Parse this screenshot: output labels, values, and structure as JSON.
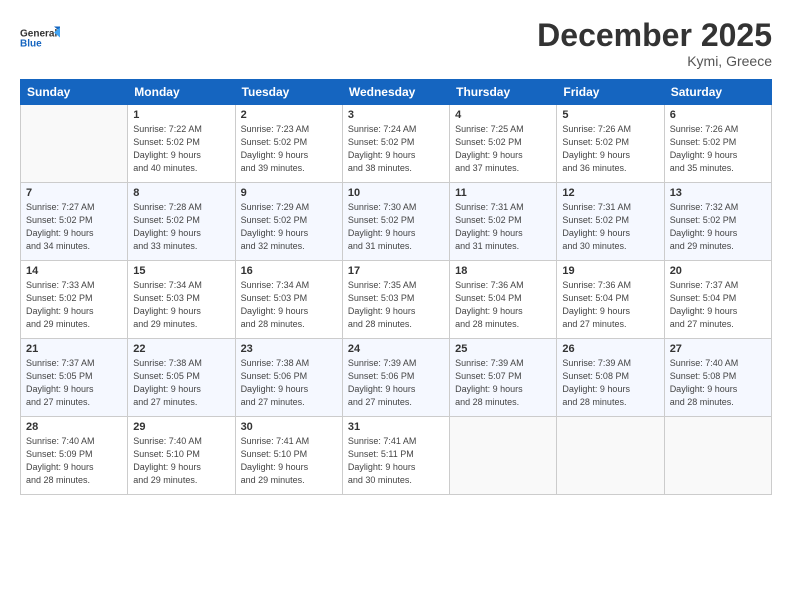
{
  "logo": {
    "line1": "General",
    "line2": "Blue"
  },
  "title": "December 2025",
  "subtitle": "Kymi, Greece",
  "days_header": [
    "Sunday",
    "Monday",
    "Tuesday",
    "Wednesday",
    "Thursday",
    "Friday",
    "Saturday"
  ],
  "weeks": [
    [
      {
        "day": "",
        "info": ""
      },
      {
        "day": "1",
        "info": "Sunrise: 7:22 AM\nSunset: 5:02 PM\nDaylight: 9 hours\nand 40 minutes."
      },
      {
        "day": "2",
        "info": "Sunrise: 7:23 AM\nSunset: 5:02 PM\nDaylight: 9 hours\nand 39 minutes."
      },
      {
        "day": "3",
        "info": "Sunrise: 7:24 AM\nSunset: 5:02 PM\nDaylight: 9 hours\nand 38 minutes."
      },
      {
        "day": "4",
        "info": "Sunrise: 7:25 AM\nSunset: 5:02 PM\nDaylight: 9 hours\nand 37 minutes."
      },
      {
        "day": "5",
        "info": "Sunrise: 7:26 AM\nSunset: 5:02 PM\nDaylight: 9 hours\nand 36 minutes."
      },
      {
        "day": "6",
        "info": "Sunrise: 7:26 AM\nSunset: 5:02 PM\nDaylight: 9 hours\nand 35 minutes."
      }
    ],
    [
      {
        "day": "7",
        "info": "Sunrise: 7:27 AM\nSunset: 5:02 PM\nDaylight: 9 hours\nand 34 minutes."
      },
      {
        "day": "8",
        "info": "Sunrise: 7:28 AM\nSunset: 5:02 PM\nDaylight: 9 hours\nand 33 minutes."
      },
      {
        "day": "9",
        "info": "Sunrise: 7:29 AM\nSunset: 5:02 PM\nDaylight: 9 hours\nand 32 minutes."
      },
      {
        "day": "10",
        "info": "Sunrise: 7:30 AM\nSunset: 5:02 PM\nDaylight: 9 hours\nand 31 minutes."
      },
      {
        "day": "11",
        "info": "Sunrise: 7:31 AM\nSunset: 5:02 PM\nDaylight: 9 hours\nand 31 minutes."
      },
      {
        "day": "12",
        "info": "Sunrise: 7:31 AM\nSunset: 5:02 PM\nDaylight: 9 hours\nand 30 minutes."
      },
      {
        "day": "13",
        "info": "Sunrise: 7:32 AM\nSunset: 5:02 PM\nDaylight: 9 hours\nand 29 minutes."
      }
    ],
    [
      {
        "day": "14",
        "info": "Sunrise: 7:33 AM\nSunset: 5:02 PM\nDaylight: 9 hours\nand 29 minutes."
      },
      {
        "day": "15",
        "info": "Sunrise: 7:34 AM\nSunset: 5:03 PM\nDaylight: 9 hours\nand 29 minutes."
      },
      {
        "day": "16",
        "info": "Sunrise: 7:34 AM\nSunset: 5:03 PM\nDaylight: 9 hours\nand 28 minutes."
      },
      {
        "day": "17",
        "info": "Sunrise: 7:35 AM\nSunset: 5:03 PM\nDaylight: 9 hours\nand 28 minutes."
      },
      {
        "day": "18",
        "info": "Sunrise: 7:36 AM\nSunset: 5:04 PM\nDaylight: 9 hours\nand 28 minutes."
      },
      {
        "day": "19",
        "info": "Sunrise: 7:36 AM\nSunset: 5:04 PM\nDaylight: 9 hours\nand 27 minutes."
      },
      {
        "day": "20",
        "info": "Sunrise: 7:37 AM\nSunset: 5:04 PM\nDaylight: 9 hours\nand 27 minutes."
      }
    ],
    [
      {
        "day": "21",
        "info": "Sunrise: 7:37 AM\nSunset: 5:05 PM\nDaylight: 9 hours\nand 27 minutes."
      },
      {
        "day": "22",
        "info": "Sunrise: 7:38 AM\nSunset: 5:05 PM\nDaylight: 9 hours\nand 27 minutes."
      },
      {
        "day": "23",
        "info": "Sunrise: 7:38 AM\nSunset: 5:06 PM\nDaylight: 9 hours\nand 27 minutes."
      },
      {
        "day": "24",
        "info": "Sunrise: 7:39 AM\nSunset: 5:06 PM\nDaylight: 9 hours\nand 27 minutes."
      },
      {
        "day": "25",
        "info": "Sunrise: 7:39 AM\nSunset: 5:07 PM\nDaylight: 9 hours\nand 28 minutes."
      },
      {
        "day": "26",
        "info": "Sunrise: 7:39 AM\nSunset: 5:08 PM\nDaylight: 9 hours\nand 28 minutes."
      },
      {
        "day": "27",
        "info": "Sunrise: 7:40 AM\nSunset: 5:08 PM\nDaylight: 9 hours\nand 28 minutes."
      }
    ],
    [
      {
        "day": "28",
        "info": "Sunrise: 7:40 AM\nSunset: 5:09 PM\nDaylight: 9 hours\nand 28 minutes."
      },
      {
        "day": "29",
        "info": "Sunrise: 7:40 AM\nSunset: 5:10 PM\nDaylight: 9 hours\nand 29 minutes."
      },
      {
        "day": "30",
        "info": "Sunrise: 7:41 AM\nSunset: 5:10 PM\nDaylight: 9 hours\nand 29 minutes."
      },
      {
        "day": "31",
        "info": "Sunrise: 7:41 AM\nSunset: 5:11 PM\nDaylight: 9 hours\nand 30 minutes."
      },
      {
        "day": "",
        "info": ""
      },
      {
        "day": "",
        "info": ""
      },
      {
        "day": "",
        "info": ""
      }
    ]
  ]
}
